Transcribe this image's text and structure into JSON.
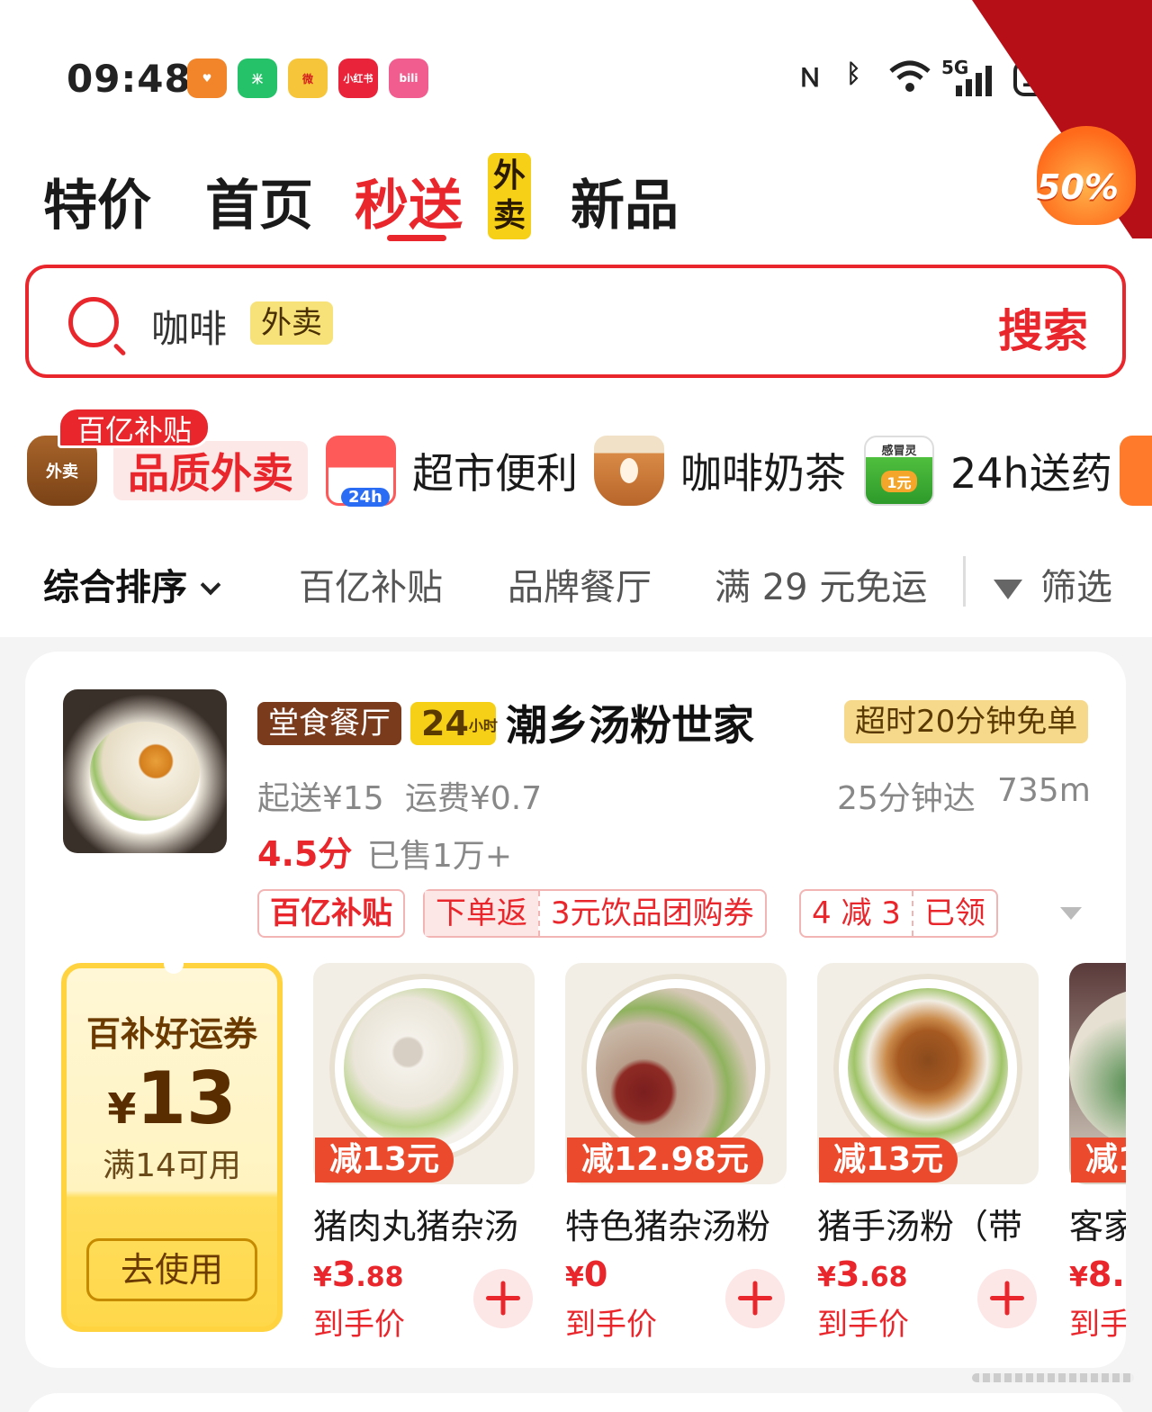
{
  "status_bar": {
    "time": "09:48",
    "apps": [
      {
        "name": "heart-app",
        "label": "♥",
        "color": "#f2842a"
      },
      {
        "name": "mi-app",
        "label": "米",
        "color": "#25c26a"
      },
      {
        "name": "weibo-app",
        "label": "微",
        "color": "#f6c53a"
      },
      {
        "name": "xiaohongshu-app",
        "label": "小红书",
        "color": "#e8233a"
      },
      {
        "name": "bilibili-app",
        "label": "bili",
        "color": "#f15d8f"
      }
    ],
    "network": "5G",
    "battery": "100"
  },
  "promo": {
    "percent": "50%"
  },
  "tabs": [
    {
      "label": "特价"
    },
    {
      "label": "首页"
    },
    {
      "label": "秒送"
    },
    {
      "label": "新品"
    }
  ],
  "tab_badge": "外卖",
  "search": {
    "query": "咖啡",
    "tag": "外卖",
    "button": "搜索"
  },
  "categories": [
    {
      "icon_label": "外卖",
      "badge": "百亿补贴",
      "label": "品质外卖"
    },
    {
      "icon_label": "24h",
      "label": "超市便利"
    },
    {
      "label": "咖啡奶茶"
    },
    {
      "icon_label": "1元",
      "icon_title": "感冒灵",
      "label": "24h送药"
    }
  ],
  "sort_bar": {
    "items": [
      "综合排序",
      "百亿补贴",
      "品牌餐厅",
      "满 29 元免运"
    ],
    "filter": "筛选"
  },
  "shop": {
    "tag_dine": "堂食餐厅",
    "tag_24": "24",
    "tag_24_small": "小时",
    "name": "潮乡汤粉世家",
    "guarantee": "超时20分钟免单",
    "min_order": "起送¥15",
    "delivery_fee": "运费¥0.7",
    "eta": "25分钟达",
    "distance": "735m",
    "rating": "4.5分",
    "sold": "已售1万+",
    "coupons": {
      "subsidy": "百亿补贴",
      "return_label": "下单返",
      "return_value": "3元饮品团购券",
      "discount": "4 减 3",
      "claimed": "已领"
    }
  },
  "lucky_coupon": {
    "title": "百补好运券",
    "currency": "¥",
    "amount": "13",
    "condition": "满14可用",
    "button": "去使用"
  },
  "dishes": [
    {
      "discount": "减13元",
      "name": "猪肉丸猪杂汤",
      "price_sym": "¥",
      "price_int": "3",
      "price_dec": ".88",
      "sub": "到手价"
    },
    {
      "discount": "减12.98元",
      "name": "特色猪杂汤粉",
      "price_sym": "¥",
      "price_int": "0",
      "price_dec": "",
      "sub": "到手价"
    },
    {
      "discount": "减13元",
      "name": "猪手汤粉（带",
      "price_sym": "¥",
      "price_int": "3",
      "price_dec": ".68",
      "sub": "到手价"
    },
    {
      "discount": "减1",
      "name": "客家",
      "price_sym": "¥",
      "price_int": "8.",
      "price_dec": "",
      "sub": "到手"
    }
  ],
  "colors": {
    "accent": "#e9262b",
    "badge_yellow": "#f5d016",
    "coupon_gold": "#ffd23f"
  }
}
